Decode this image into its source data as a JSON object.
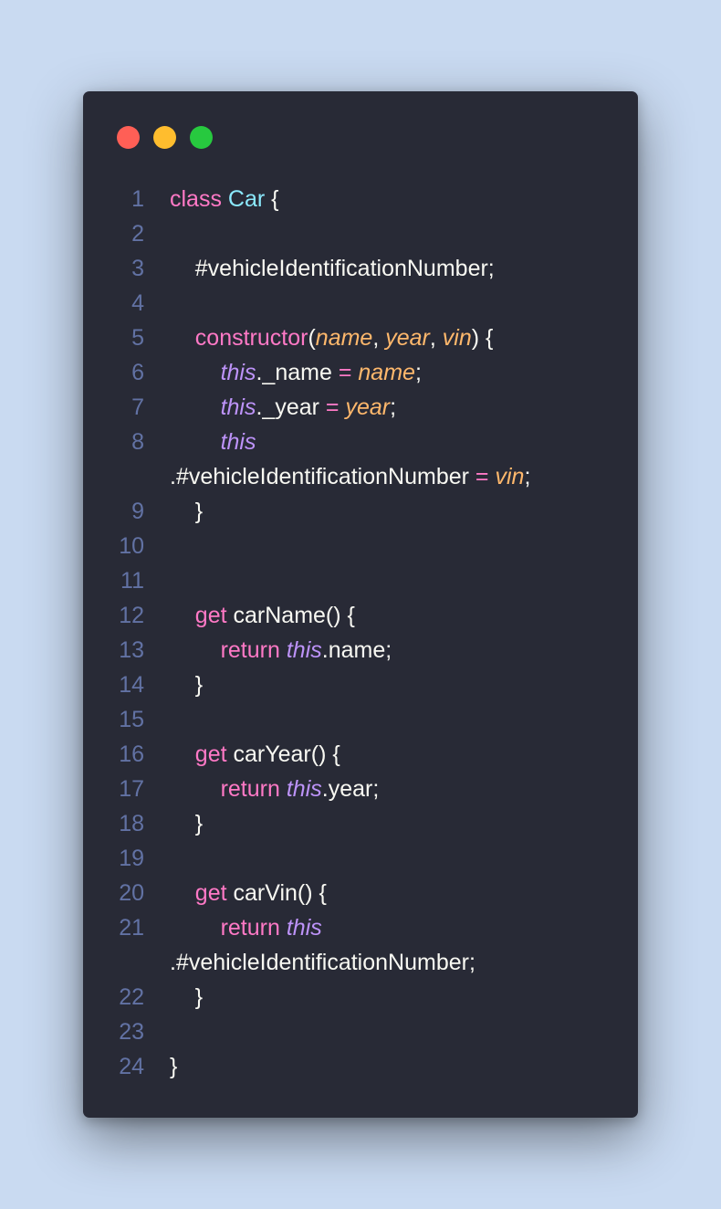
{
  "window": {
    "controls": {
      "close_color": "#ff5f56",
      "minimize_color": "#ffbd2e",
      "maximize_color": "#27c93f"
    }
  },
  "theme": {
    "background": "#282a36",
    "foreground": "#f8f8f2",
    "keyword": "#ff79c6",
    "class_name": "#8be9fd",
    "parameter": "#ffb86c",
    "this_keyword": "#bd93f9",
    "line_number": "#6272a4"
  },
  "code": {
    "lines": [
      {
        "n": "1",
        "tokens": [
          [
            "kw",
            "class"
          ],
          [
            "p",
            " "
          ],
          [
            "cls",
            "Car"
          ],
          [
            "p",
            " {"
          ]
        ]
      },
      {
        "n": "2",
        "tokens": []
      },
      {
        "n": "3",
        "tokens": [
          [
            "p",
            "    #vehicleIdentificationNumber;"
          ]
        ]
      },
      {
        "n": "4",
        "tokens": []
      },
      {
        "n": "5",
        "tokens": [
          [
            "p",
            "    "
          ],
          [
            "kw",
            "constructor"
          ],
          [
            "p",
            "("
          ],
          [
            "param",
            "name"
          ],
          [
            "p",
            ", "
          ],
          [
            "param",
            "year"
          ],
          [
            "p",
            ", "
          ],
          [
            "param",
            "vin"
          ],
          [
            "p",
            ") {"
          ]
        ]
      },
      {
        "n": "6",
        "tokens": [
          [
            "p",
            "        "
          ],
          [
            "this",
            "this"
          ],
          [
            "p",
            "._name "
          ],
          [
            "kw",
            "="
          ],
          [
            "p",
            " "
          ],
          [
            "param",
            "name"
          ],
          [
            "p",
            ";"
          ]
        ]
      },
      {
        "n": "7",
        "tokens": [
          [
            "p",
            "        "
          ],
          [
            "this",
            "this"
          ],
          [
            "p",
            "._year "
          ],
          [
            "kw",
            "="
          ],
          [
            "p",
            " "
          ],
          [
            "param",
            "year"
          ],
          [
            "p",
            ";"
          ]
        ]
      },
      {
        "n": "8",
        "tokens": [
          [
            "p",
            "        "
          ],
          [
            "this",
            "this"
          ]
        ]
      },
      {
        "n": "",
        "tokens": [
          [
            "p",
            ".#vehicleIdentificationNumber "
          ],
          [
            "kw",
            "="
          ],
          [
            "p",
            " "
          ],
          [
            "param",
            "vin"
          ],
          [
            "p",
            ";"
          ]
        ]
      },
      {
        "n": "9",
        "tokens": [
          [
            "p",
            "    }"
          ]
        ]
      },
      {
        "n": "10",
        "tokens": []
      },
      {
        "n": "11",
        "tokens": []
      },
      {
        "n": "12",
        "tokens": [
          [
            "p",
            "    "
          ],
          [
            "kw",
            "get"
          ],
          [
            "p",
            " carName() {"
          ]
        ]
      },
      {
        "n": "13",
        "tokens": [
          [
            "p",
            "        "
          ],
          [
            "kw",
            "return"
          ],
          [
            "p",
            " "
          ],
          [
            "this",
            "this"
          ],
          [
            "p",
            ".name;"
          ]
        ]
      },
      {
        "n": "14",
        "tokens": [
          [
            "p",
            "    }"
          ]
        ]
      },
      {
        "n": "15",
        "tokens": []
      },
      {
        "n": "16",
        "tokens": [
          [
            "p",
            "    "
          ],
          [
            "kw",
            "get"
          ],
          [
            "p",
            " carYear() {"
          ]
        ]
      },
      {
        "n": "17",
        "tokens": [
          [
            "p",
            "        "
          ],
          [
            "kw",
            "return"
          ],
          [
            "p",
            " "
          ],
          [
            "this",
            "this"
          ],
          [
            "p",
            ".year;"
          ]
        ]
      },
      {
        "n": "18",
        "tokens": [
          [
            "p",
            "    }"
          ]
        ]
      },
      {
        "n": "19",
        "tokens": []
      },
      {
        "n": "20",
        "tokens": [
          [
            "p",
            "    "
          ],
          [
            "kw",
            "get"
          ],
          [
            "p",
            " carVin() {"
          ]
        ]
      },
      {
        "n": "21",
        "tokens": [
          [
            "p",
            "        "
          ],
          [
            "kw",
            "return"
          ],
          [
            "p",
            " "
          ],
          [
            "this",
            "this"
          ]
        ]
      },
      {
        "n": "",
        "tokens": [
          [
            "p",
            ".#vehicleIdentificationNumber;"
          ]
        ]
      },
      {
        "n": "22",
        "tokens": [
          [
            "p",
            "    }"
          ]
        ]
      },
      {
        "n": "23",
        "tokens": []
      },
      {
        "n": "24",
        "tokens": [
          [
            "p",
            "}"
          ]
        ]
      }
    ]
  }
}
